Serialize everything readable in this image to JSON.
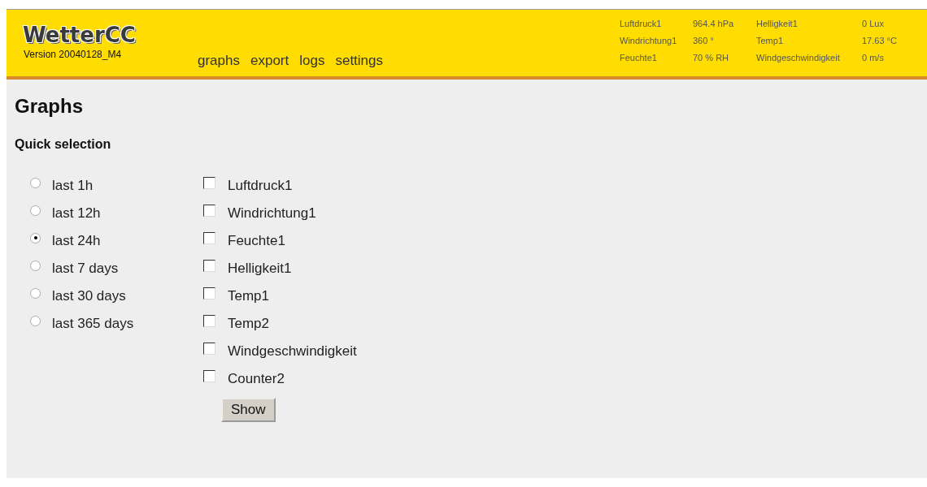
{
  "header": {
    "logo": "WetterCC",
    "version": "Version 20040128_M4",
    "nav": [
      "graphs",
      "export",
      "logs",
      "settings"
    ],
    "readings": [
      {
        "label": "Luftdruck1",
        "value": "964.4 hPa"
      },
      {
        "label": "Helligkeit1",
        "value": "0 Lux"
      },
      {
        "label": "Windrichtung1",
        "value": "360 °"
      },
      {
        "label": "Temp1",
        "value": "17.63 °C"
      },
      {
        "label": "Feuchte1",
        "value": "70 % RH"
      },
      {
        "label": "Windgeschwindigkeit",
        "value": "0 m/s"
      }
    ]
  },
  "title": "Graphs",
  "subtitle": "Quick selection",
  "ranges": [
    {
      "label": "last 1h",
      "selected": false
    },
    {
      "label": "last 12h",
      "selected": false
    },
    {
      "label": "last 24h",
      "selected": true
    },
    {
      "label": "last 7 days",
      "selected": false
    },
    {
      "label": "last 30 days",
      "selected": false
    },
    {
      "label": "last 365 days",
      "selected": false
    }
  ],
  "sensors": [
    {
      "label": "Luftdruck1",
      "checked": false
    },
    {
      "label": "Windrichtung1",
      "checked": false
    },
    {
      "label": "Feuchte1",
      "checked": false
    },
    {
      "label": "Helligkeit1",
      "checked": false
    },
    {
      "label": "Temp1",
      "checked": false
    },
    {
      "label": "Temp2",
      "checked": false
    },
    {
      "label": "Windgeschwindigkeit",
      "checked": false
    },
    {
      "label": "Counter2",
      "checked": false
    }
  ],
  "button": "Show"
}
